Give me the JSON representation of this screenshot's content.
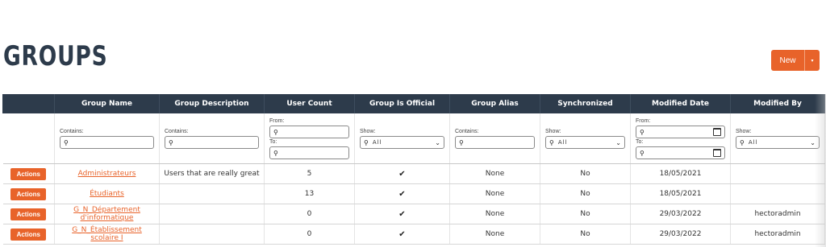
{
  "page": {
    "title": "GROUPS"
  },
  "toolbar": {
    "new_label": "New",
    "caret": "▾"
  },
  "columns": [
    "",
    "Group Name",
    "Group Description",
    "User Count",
    "Group Is Official",
    "Group Alias",
    "Synchronized",
    "Modified Date",
    "Modified By"
  ],
  "filters": {
    "contains_label": "Contains:",
    "from_label": "From:",
    "to_label": "To:",
    "show_label": "Show:",
    "all_option": "All"
  },
  "actions_label": "Actions",
  "rows": [
    {
      "name_lines": [
        "Administrateurs"
      ],
      "description": "Users that are really great",
      "user_count": "5",
      "official": "✔",
      "alias": "None",
      "synchronized": "No",
      "modified_date": "18/05/2021",
      "modified_by": ""
    },
    {
      "name_lines": [
        "Étudiants"
      ],
      "description": "",
      "user_count": "13",
      "official": "✔",
      "alias": "None",
      "synchronized": "No",
      "modified_date": "18/05/2021",
      "modified_by": ""
    },
    {
      "name_lines": [
        "G_N_Département",
        "d'informatique"
      ],
      "description": "",
      "user_count": "0",
      "official": "✔",
      "alias": "None",
      "synchronized": "No",
      "modified_date": "29/03/2022",
      "modified_by": "hectoradmin"
    },
    {
      "name_lines": [
        "G_N_Établissement",
        "scolaire I"
      ],
      "description": "",
      "user_count": "0",
      "official": "✔",
      "alias": "None",
      "synchronized": "No",
      "modified_date": "29/03/2022",
      "modified_by": "hectoradmin"
    }
  ],
  "colors": {
    "header_bg": "#2d3b4b",
    "accent": "#e8632a"
  },
  "icons": {
    "search": "search-icon",
    "calendar": "calendar-icon",
    "chevron": "chevron-down-icon",
    "check": "checkmark-icon"
  }
}
